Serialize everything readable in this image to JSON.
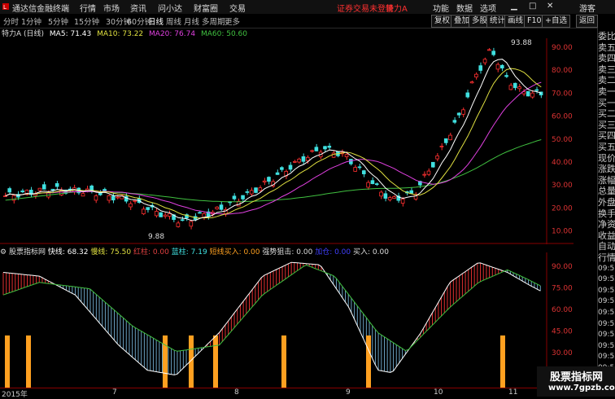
{
  "titlebar": {
    "app_title": "通达信金融终端",
    "menus": [
      "行情",
      "市场",
      "资讯",
      "问小达",
      "财富圈",
      "交易"
    ],
    "notice": "证券交易未登录",
    "stock_name": "特力A",
    "right_menus": [
      "功能",
      "数据",
      "选项"
    ],
    "user": "游客"
  },
  "toolbar": {
    "periods": [
      "分时",
      "1分钟",
      "5分钟",
      "15分钟",
      "30分钟",
      "60分钟",
      "日线",
      "周线",
      "月线",
      "多周期",
      "更多"
    ],
    "active_period": "日线",
    "right_buttons": [
      "复权",
      "叠加",
      "多股",
      "统计",
      "画线",
      "F10",
      "+自选",
      "返回"
    ]
  },
  "main_chart": {
    "stock_label": "特力A (日线)",
    "ma5": "MA5: 71.43",
    "ma10": "MA10: 73.22",
    "ma20": "MA20: 76.74",
    "ma60": "MA60: 50.60",
    "high_label": "93.88",
    "low_label": "9.88",
    "y_ticks": [
      "90.00",
      "80.00",
      "70.00",
      "60.00",
      "50.00",
      "40.00",
      "30.00",
      "20.00",
      "10.00"
    ],
    "colors": {
      "ma5": "#ffffff",
      "ma10": "#e0e040",
      "ma20": "#e040e0",
      "ma60": "#40c040",
      "up": "#ff3030",
      "down": "#40e0e0"
    }
  },
  "indicator_chart": {
    "name": "股票指标网",
    "fast": "快线: 68.32",
    "slow": "慢线: 75.50",
    "red_bar": "红柱: 0.00",
    "blue_bar": "蓝柱: 7.19",
    "short_buy": "短线买入: 0.00",
    "strong_attack": "强势狙击: 0.00",
    "extra": "加仓: 0.00",
    "buy": "买入: 0.00",
    "y_ticks": [
      "90.00",
      "75.00",
      "60.00",
      "45.00",
      "30.00",
      "15.00"
    ]
  },
  "x_axis": [
    "2015年",
    "7",
    "8",
    "9",
    "10",
    "11"
  ],
  "sidebar": {
    "items": [
      "委比",
      "卖五",
      "卖四",
      "卖三",
      "卖二",
      "卖一",
      "买一",
      "买二",
      "买三",
      "买四",
      "买五",
      "现价",
      "涨跌",
      "涨幅",
      "总量",
      "外盘",
      "换手",
      "净资",
      "收益",
      "自动",
      "行情",
      "09:51",
      "09:52",
      "09:52",
      "09:52",
      "09:52",
      "09:52",
      "09:52",
      "09:52",
      "09:52",
      "09:53",
      "09:53"
    ]
  },
  "watermark": {
    "cn": "股票指标网",
    "url": "www.7gpzb.com"
  }
}
